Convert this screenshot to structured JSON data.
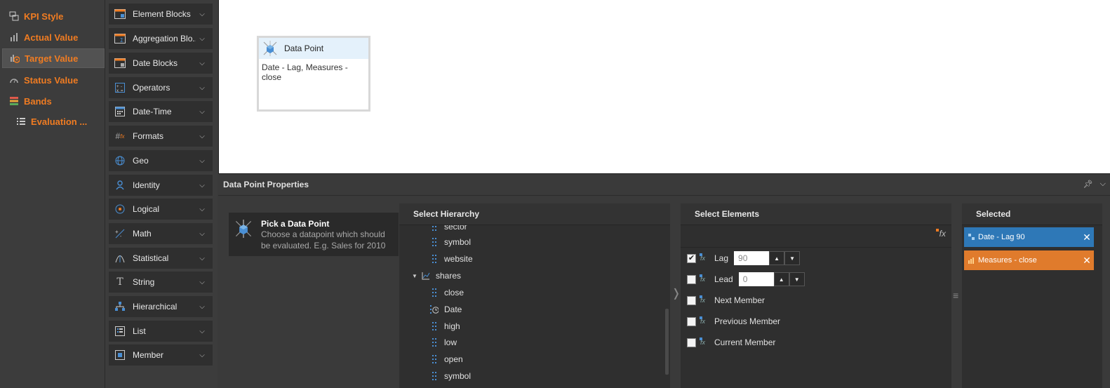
{
  "left_nav": {
    "items": [
      {
        "label": "KPI Style",
        "icon": "kpi-style-icon",
        "active": false
      },
      {
        "label": "Actual Value",
        "icon": "bar-chart-icon",
        "active": false
      },
      {
        "label": "Target Value",
        "icon": "target-icon",
        "active": true
      },
      {
        "label": "Status Value",
        "icon": "gauge-icon",
        "active": false
      },
      {
        "label": "Bands",
        "icon": "bands-icon",
        "active": false
      },
      {
        "label": "Evaluation ...",
        "icon": "list-icon",
        "active": false
      }
    ]
  },
  "palette": {
    "items": [
      {
        "label": "Element Blocks",
        "icon": "element-blocks-icon"
      },
      {
        "label": "Aggregation Blo...",
        "icon": "aggregation-icon"
      },
      {
        "label": "Date Blocks",
        "icon": "date-blocks-icon"
      },
      {
        "label": "Operators",
        "icon": "operators-icon"
      },
      {
        "label": "Date-Time",
        "icon": "calendar-icon"
      },
      {
        "label": "Formats",
        "icon": "formats-icon"
      },
      {
        "label": "Geo",
        "icon": "globe-icon"
      },
      {
        "label": "Identity",
        "icon": "person-icon"
      },
      {
        "label": "Logical",
        "icon": "logical-icon"
      },
      {
        "label": "Math",
        "icon": "math-icon"
      },
      {
        "label": "Statistical",
        "icon": "statistical-icon"
      },
      {
        "label": "String",
        "icon": "string-icon"
      },
      {
        "label": "Hierarchical",
        "icon": "hierarchy-icon"
      },
      {
        "label": "List",
        "icon": "list-icon"
      },
      {
        "label": "Member",
        "icon": "member-icon"
      }
    ]
  },
  "canvas": {
    "node": {
      "title": "Data Point",
      "body": "Date - Lag, Measures - close"
    }
  },
  "properties": {
    "title": "Data Point Properties",
    "pick": {
      "title": "Pick a Data Point",
      "description": "Choose a datapoint which should be evaluated. E.g. Sales for 2010"
    },
    "hierarchy": {
      "header": "Select Hierarchy",
      "rows": [
        {
          "label": "sector",
          "type": "level",
          "indent": 2
        },
        {
          "label": "symbol",
          "type": "level",
          "indent": 2
        },
        {
          "label": "website",
          "type": "level",
          "indent": 2
        },
        {
          "label": "shares",
          "type": "measure-group",
          "indent": 1,
          "expanded": true
        },
        {
          "label": "close",
          "type": "level",
          "indent": 2
        },
        {
          "label": "Date",
          "type": "date",
          "indent": 2
        },
        {
          "label": "high",
          "type": "level",
          "indent": 2
        },
        {
          "label": "low",
          "type": "level",
          "indent": 2
        },
        {
          "label": "open",
          "type": "level",
          "indent": 2
        },
        {
          "label": "symbol",
          "type": "level",
          "indent": 2
        }
      ]
    },
    "elements": {
      "header": "Select Elements",
      "fx_label": "fx",
      "rows": [
        {
          "label": "Lag",
          "checked": true,
          "value": "90",
          "has_input": true
        },
        {
          "label": "Lead",
          "checked": false,
          "value": "0",
          "has_input": true
        },
        {
          "label": "Next Member",
          "checked": false,
          "has_input": false
        },
        {
          "label": "Previous Member",
          "checked": false,
          "has_input": false
        },
        {
          "label": "Current Member",
          "checked": false,
          "has_input": false
        }
      ]
    },
    "selected": {
      "header": "Selected",
      "chips": [
        {
          "label": "Date - Lag 90",
          "color": "#2e78b7"
        },
        {
          "label": "Measures - close",
          "color": "#e07b2c"
        }
      ]
    }
  },
  "colors": {
    "accent_orange": "#f07c22",
    "chip_blue": "#2e78b7",
    "chip_orange": "#e07b2c"
  }
}
